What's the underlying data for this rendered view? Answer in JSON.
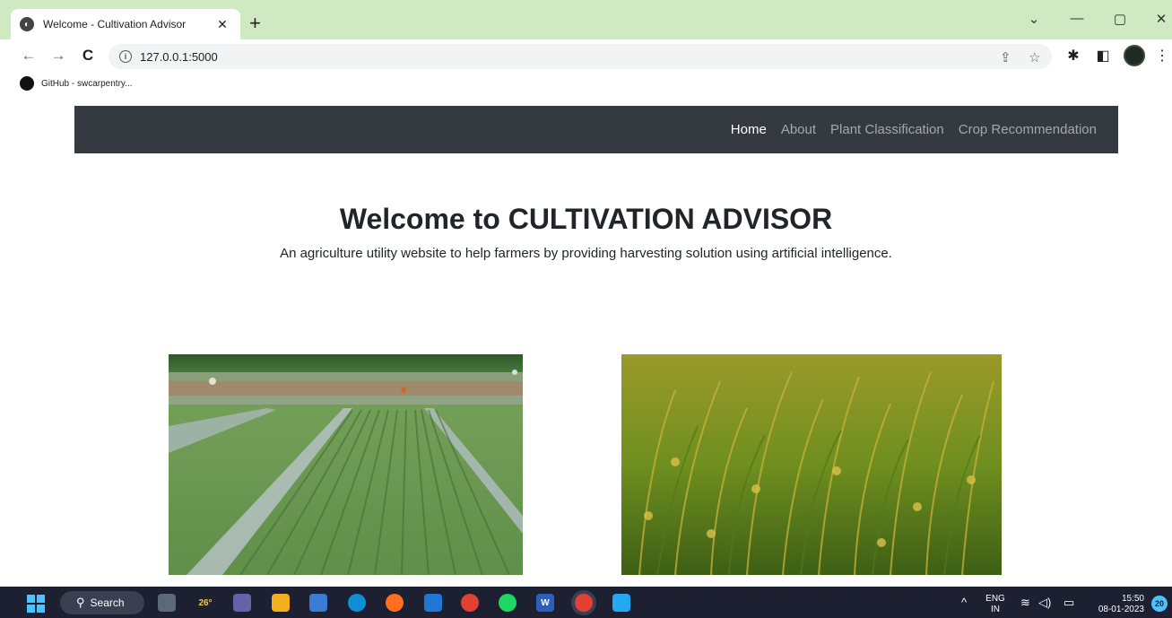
{
  "browser": {
    "tab_title": "Welcome - Cultivation Advisor",
    "tab_close": "✕",
    "new_tab": "+",
    "url": "127.0.0.1:5000",
    "bookmark": "GitHub - swcarpentry...",
    "controls": {
      "dropdown": "⌄",
      "minimize": "—",
      "restore": "▢",
      "close": "✕"
    },
    "nav": {
      "back": "←",
      "forward": "→",
      "reload": "C"
    }
  },
  "site": {
    "nav_items": [
      {
        "label": "Home",
        "active": true
      },
      {
        "label": "About",
        "active": false
      },
      {
        "label": "Plant Classification",
        "active": false
      },
      {
        "label": "Crop Recommendation",
        "active": false
      }
    ],
    "title": "Welcome to CULTIVATION ADVISOR",
    "subtitle": "An agriculture utility website to help farmers by providing harvesting solution using artificial intelligence."
  },
  "taskbar": {
    "search_label": "Search",
    "weather": "26°",
    "language_top": "ENG",
    "language_bottom": "IN",
    "time": "15:50",
    "date": "08-01-2023",
    "notifications": "20"
  },
  "colors": {
    "tab_strip": "#cfe9c2",
    "site_nav": "#343a40",
    "taskbar": "#1c2030",
    "accent": "#4cc2ff"
  }
}
